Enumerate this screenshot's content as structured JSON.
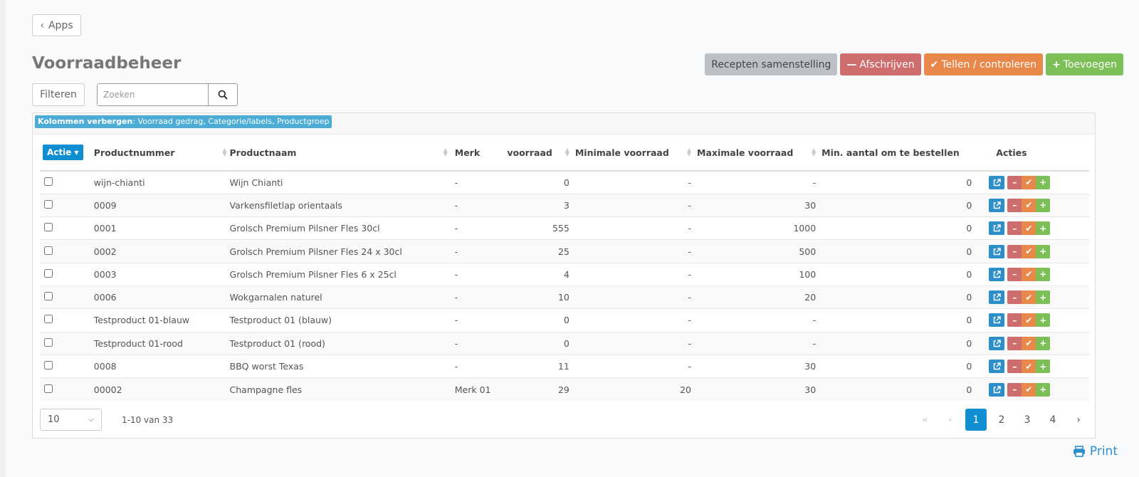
{
  "nav": {
    "back_label": "Apps"
  },
  "page": {
    "title": "Voorraadbeheer"
  },
  "actions": {
    "recepten": "Recepten samenstelling",
    "afschrijven": "Afschrijven",
    "tellen": "Tellen / controleren",
    "toevoegen": "Toevoegen"
  },
  "toolbar": {
    "filter_label": "Filteren",
    "search_placeholder": "Zoeken"
  },
  "hidden_columns": {
    "label": "Kolommen verbergen",
    "value": ": Voorraad gedrag, Categorie/labels, Productgroep"
  },
  "table": {
    "actie_label": "Actie",
    "headers": {
      "productnummer": "Productnummer",
      "productnaam": "Productnaam",
      "merk": "Merk",
      "voorraad": "voorraad",
      "min_voorraad": "Minimale voorraad",
      "max_voorraad": "Maximale voorraad",
      "min_bestellen": "Min. aantal om te bestellen",
      "acties": "Acties"
    },
    "rows": [
      {
        "nummer": "wijn-chianti",
        "naam": "Wijn Chianti",
        "merk": "-",
        "voorraad": "0",
        "min": "-",
        "max": "-",
        "bestel": "0"
      },
      {
        "nummer": "0009",
        "naam": "Varkensfiletlap orientaals",
        "merk": "-",
        "voorraad": "3",
        "min": "-",
        "max": "30",
        "bestel": "0"
      },
      {
        "nummer": "0001",
        "naam": "Grolsch Premium Pilsner Fles 30cl",
        "merk": "-",
        "voorraad": "555",
        "min": "-",
        "max": "1000",
        "bestel": "0"
      },
      {
        "nummer": "0002",
        "naam": "Grolsch Premium Pilsner Fles 24 x 30cl",
        "merk": "-",
        "voorraad": "25",
        "min": "-",
        "max": "500",
        "bestel": "0"
      },
      {
        "nummer": "0003",
        "naam": "Grolsch Premium Pilsner Fles 6 x 25cl",
        "merk": "-",
        "voorraad": "4",
        "min": "-",
        "max": "100",
        "bestel": "0"
      },
      {
        "nummer": "0006",
        "naam": "Wokgarnalen naturel",
        "merk": "-",
        "voorraad": "10",
        "min": "-",
        "max": "20",
        "bestel": "0"
      },
      {
        "nummer": "Testproduct 01-blauw",
        "naam": "Testproduct 01 (blauw)",
        "merk": "-",
        "voorraad": "0",
        "min": "-",
        "max": "-",
        "bestel": "0"
      },
      {
        "nummer": "Testproduct 01-rood",
        "naam": "Testproduct 01 (rood)",
        "merk": "-",
        "voorraad": "0",
        "min": "-",
        "max": "-",
        "bestel": "0"
      },
      {
        "nummer": "0008",
        "naam": "BBQ worst Texas",
        "merk": "-",
        "voorraad": "11",
        "min": "-",
        "max": "30",
        "bestel": "0"
      },
      {
        "nummer": "00002",
        "naam": "Champagne fles",
        "merk": "Merk 01",
        "voorraad": "29",
        "min": "20",
        "max": "30",
        "bestel": "0"
      }
    ]
  },
  "pagination": {
    "page_size": "10",
    "range": "1-10 van 33",
    "pages": [
      "1",
      "2",
      "3",
      "4"
    ],
    "current": "1"
  },
  "print_label": "Print",
  "colors": {
    "primary": "#0f8ed1",
    "danger": "#cd6d6d",
    "warning": "#e8884a",
    "success": "#7cbf57",
    "info": "#4badd5"
  }
}
